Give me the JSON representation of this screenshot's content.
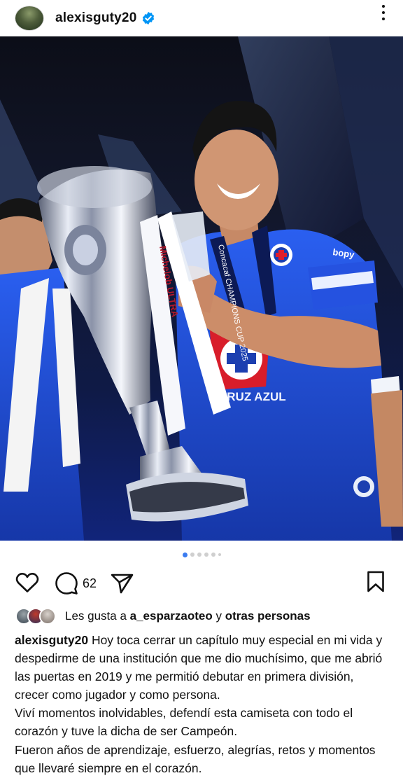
{
  "post": {
    "username": "alexisguty20",
    "verified": true,
    "more_icon": "more-vertical-icon"
  },
  "carousel": {
    "total": 6,
    "active_index": 0
  },
  "actions": {
    "comment_count": "62",
    "icons": [
      "heart-icon",
      "comment-icon",
      "share-icon",
      "bookmark-icon"
    ]
  },
  "likes": {
    "prefix": "Les gusta a ",
    "user": "a_esparzaoteo",
    "connector": " y ",
    "others": "otras personas"
  },
  "caption": {
    "username": "alexisguty20",
    "lines": [
      "Hoy toca cerrar un capítulo muy especial en mi vida y despedirme de una institución que me dio muchísimo, que me abrió las puertas en 2019 y me permitió debutar en primera división, crecer como jugador y como persona.",
      "Viví momentos inolvidables, defendí esta camiseta con todo el corazón y tuve la dicha de ser Campeón.",
      "Fueron años de aprendizaje, esfuerzo, alegrías, retos y momentos que llevaré siempre en el corazón."
    ]
  },
  "photo_text": {
    "ribbon_brand": "Michelob ULTRA",
    "lanyard": "Concacaf CHAMPIONS CUP 2025",
    "shirt_text": "CRUZ AZUL",
    "sleeve": "bopy"
  },
  "colors": {
    "verified": "#0095f6",
    "active_dot": "#3a7bf0",
    "jersey": "#1e4fd6"
  }
}
